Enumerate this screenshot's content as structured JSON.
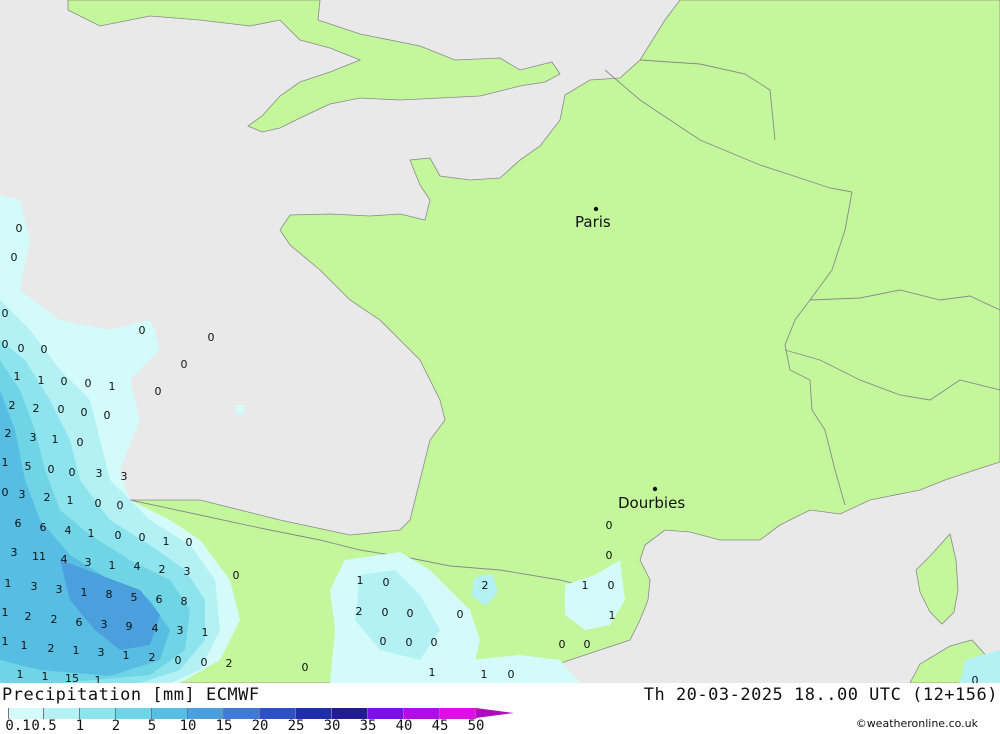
{
  "map": {
    "cities": [
      {
        "name": "Paris",
        "lon": 2.35,
        "lat": 48.86
      },
      {
        "name": "Dourbies",
        "lon": 3.45,
        "lat": 44.07
      }
    ],
    "colors": {
      "sea": "#e9e9e9",
      "land": "#c4f79c",
      "border": "#8a8a8a",
      "coast": "#8a8a8a"
    },
    "precip_values": [
      "0",
      "0",
      "0",
      "0",
      "0",
      "0",
      "0",
      "0",
      "0",
      "0",
      "0",
      "1",
      "1",
      "0",
      "0",
      "1",
      "0",
      "2",
      "2",
      "0",
      "1",
      "0",
      "2",
      "3",
      "1",
      "0",
      "3",
      "3",
      "5",
      "0",
      "0",
      "0",
      "3",
      "2",
      "1",
      "0",
      "6",
      "6",
      "4",
      "1",
      "0",
      "0",
      "1",
      "0",
      "3",
      "11",
      "4",
      "3",
      "1",
      "4",
      "2",
      "3",
      "0",
      "1",
      "3",
      "3",
      "1",
      "8",
      "5",
      "6",
      "8",
      "1",
      "2",
      "2",
      "6",
      "3",
      "9",
      "4",
      "3",
      "1",
      "1",
      "1",
      "2",
      "1",
      "3",
      "1",
      "2",
      "0",
      "0",
      "2",
      "1",
      "1",
      "15",
      "1",
      "0",
      "1",
      "0",
      "2",
      "2",
      "0",
      "0",
      "0",
      "0",
      "0",
      "0",
      "1",
      "1",
      "0",
      "0",
      "0",
      "0",
      "0",
      "1",
      "0",
      "1",
      "0",
      "0",
      "0",
      "1"
    ]
  },
  "footer": {
    "title": "Precipitation [mm] ECMWF",
    "datetime": "Th 20-03-2025 18..00 UTC (12+156)",
    "credit": "©weatheronline.co.uk"
  },
  "legend": {
    "labels": [
      "0.1",
      "0.5",
      "1",
      "2",
      "5",
      "10",
      "15",
      "20",
      "25",
      "30",
      "35",
      "40",
      "45",
      "50"
    ],
    "colors": [
      "#d2fbfa",
      "#b4f1f4",
      "#8ee4ec",
      "#6ed4e6",
      "#58bde2",
      "#4a9fdc",
      "#3f7ad8",
      "#2d50c8",
      "#1d2dac",
      "#221b96",
      "#7d10ea",
      "#b40ce6",
      "#e00ee6",
      "#b00ac0"
    ]
  }
}
